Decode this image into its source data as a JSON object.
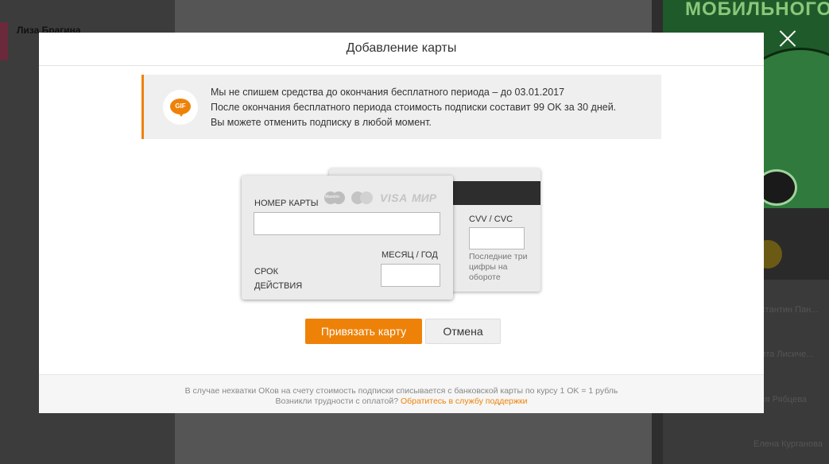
{
  "background": {
    "user_name": "Лиза Брагина",
    "banner_text": "МОБИЛЬНОГО?",
    "list_items": [
      "...стантин Пан...",
      "...ита Лисиче...",
      "...ся Рябцева",
      "Елена Курганова"
    ]
  },
  "modal": {
    "title": "Добавление карты",
    "notice": {
      "icon_text": "GIF",
      "line1": "Мы не спишем средства до окончания бесплатного периода – до 03.01.2017",
      "line2": "После окончания бесплатного периода стоимость подписки составит 99 OK за 30 дней.",
      "line3": "Вы можете отменить подписку в любой момент."
    },
    "card": {
      "number_label": "НОМЕР КАРТЫ",
      "number_value": "",
      "logos": {
        "maestro": "Maestro",
        "visa": "VISA",
        "mir": "МИР"
      },
      "expiry_label": "СРОК ДЕЙСТВИЯ",
      "month_year_label": "МЕСЯЦ / ГОД",
      "month_year_value": "",
      "cvv_label": "CVV / CVC",
      "cvv_value": "",
      "cvv_hint": "Последние три цифры на обороте"
    },
    "buttons": {
      "submit": "Привязать карту",
      "cancel": "Отмена"
    },
    "footer": {
      "line1": "В случае нехватки ОКов на счету стоимость подписки списывается с банковской карты по курсу 1 OK = 1 рубль",
      "line2_text": "Возникли трудности с оплатой?",
      "support_link": "Обратитесь в службу поддержки"
    }
  },
  "colors": {
    "accent": "#ee8208",
    "overlay": "#4a4a4a"
  }
}
